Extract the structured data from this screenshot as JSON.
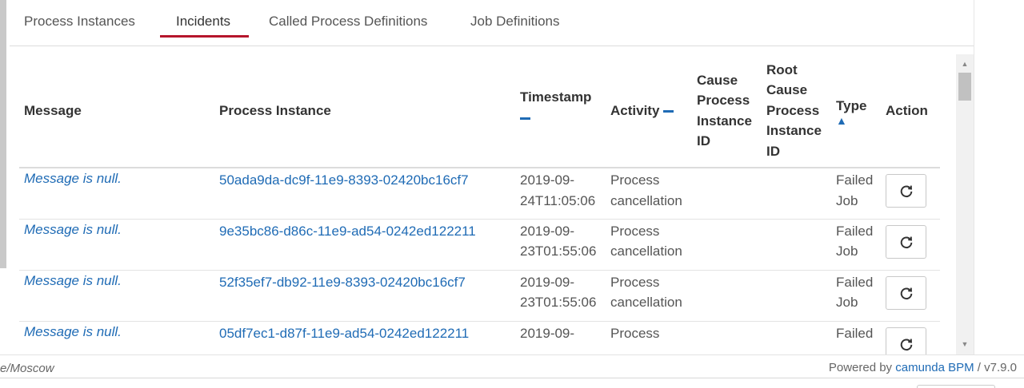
{
  "tabs": [
    {
      "label": "Process Instances"
    },
    {
      "label": "Incidents"
    },
    {
      "label": "Called Process Definitions"
    },
    {
      "label": "Job Definitions"
    }
  ],
  "active_tab": "Incidents",
  "table": {
    "headers": {
      "message": "Message",
      "process_instance": "Process Instance",
      "timestamp": "Timestamp",
      "activity": "Activity",
      "cause_1": "Cause",
      "cause_2": "Process",
      "cause_3": "Instance",
      "cause_4": "ID",
      "root_1": "Root",
      "root_2": "Cause",
      "root_3": "Process",
      "root_4": "Instance",
      "root_5": "ID",
      "type": "Type",
      "action": "Action"
    },
    "sort": {
      "timestamp": "none",
      "activity": "none",
      "type": "ascending"
    },
    "rows": [
      {
        "message": "Message is null.",
        "process_instance": "50ada9da-dc9f-11e9-8393-02420bc16cf7",
        "timestamp_date": "2019-09-",
        "timestamp_time": "24T11:05:06",
        "activity_1": "Process",
        "activity_2": "cancellation",
        "type_1": "Failed",
        "type_2": "Job"
      },
      {
        "message": "Message is null.",
        "process_instance": "9e35bc86-d86c-11e9-ad54-0242ed122211",
        "timestamp_date": "2019-09-",
        "timestamp_time": "23T01:55:06",
        "activity_1": "Process",
        "activity_2": "cancellation",
        "type_1": "Failed",
        "type_2": "Job"
      },
      {
        "message": "Message is null.",
        "process_instance": "52f35ef7-db92-11e9-8393-02420bc16cf7",
        "timestamp_date": "2019-09-",
        "timestamp_time": "23T01:55:06",
        "activity_1": "Process",
        "activity_2": "cancellation",
        "type_1": "Failed",
        "type_2": "Job"
      },
      {
        "message": "Message is null.",
        "process_instance": "05df7ec1-d87f-11e9-ad54-0242ed122211",
        "timestamp_date": "2019-09-",
        "timestamp_time": "",
        "activity_1": "Process",
        "activity_2": "",
        "type_1": "Failed",
        "type_2": ""
      }
    ],
    "action_icon": "refresh-icon"
  },
  "footer": {
    "timezone": "e/Moscow",
    "powered_by": "Powered by",
    "brand": "camunda BPM",
    "version": "/ v7.9.0"
  },
  "colors": {
    "accent": "#b5152b",
    "link": "#1f6bb5"
  }
}
